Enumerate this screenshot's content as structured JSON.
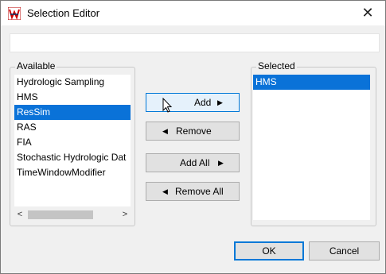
{
  "window": {
    "title": "Selection Editor",
    "close_glyph": "✕"
  },
  "filter": {
    "value": ""
  },
  "available": {
    "label": "Available",
    "items": [
      "Hydrologic Sampling",
      "HMS",
      "ResSim",
      "RAS",
      "FIA",
      "Stochastic Hydrologic Dat",
      "TimeWindowModifier"
    ],
    "selected_index": 2
  },
  "selected": {
    "label": "Selected",
    "items": [
      "HMS"
    ],
    "selected_index": 0
  },
  "buttons": {
    "add": "Add",
    "remove": "Remove",
    "add_all": "Add All",
    "remove_all": "Remove All",
    "ok": "OK",
    "cancel": "Cancel"
  },
  "icons": {
    "right_arrow": "▶",
    "left_arrow": "◀",
    "scroll_left": "<",
    "scroll_right": ">"
  },
  "colors": {
    "selection": "#0a72d8",
    "focus_border": "#0078d7"
  }
}
